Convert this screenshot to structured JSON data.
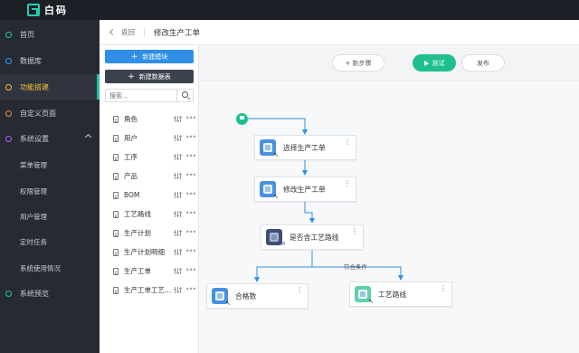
{
  "app": {
    "logo_text": "白码"
  },
  "sidebar": {
    "items": [
      {
        "label": "首页",
        "dot_color": "#20c39f"
      },
      {
        "label": "数据库",
        "dot_color": "#2f9cf4"
      },
      {
        "label": "功能搭建",
        "dot_color": "#f5c13b",
        "active": true
      },
      {
        "label": "自定义页面",
        "dot_color": "#f08a3c"
      },
      {
        "label": "系统设置",
        "dot_color": "#9b6cf0",
        "expanded": true
      }
    ],
    "sub_items": [
      {
        "label": "菜单管理"
      },
      {
        "label": "权限管理"
      },
      {
        "label": "用户管理"
      },
      {
        "label": "定时任务"
      },
      {
        "label": "系统使用情况"
      }
    ],
    "last_item": {
      "label": "系统预览",
      "dot_color": "#20c39f"
    }
  },
  "header": {
    "back_label": "返回",
    "title": "修改生产工单"
  },
  "module_panel": {
    "new_module_label": "新建模块",
    "new_table_label": "新建数据表",
    "search_placeholder": "搜索...",
    "items": [
      {
        "label": "角色"
      },
      {
        "label": "用户"
      },
      {
        "label": "工序"
      },
      {
        "label": "产品"
      },
      {
        "label": "BOM"
      },
      {
        "label": "工艺路线"
      },
      {
        "label": "生产计划"
      },
      {
        "label": "生产计划明细"
      },
      {
        "label": "生产工单"
      },
      {
        "label": "生产工单工艺..."
      }
    ]
  },
  "toolbar": {
    "new_step_label": "+ 新步骤",
    "test_label": "测试",
    "publish_label": "发布"
  },
  "flow": {
    "nodes": [
      {
        "label": "选择生产工单",
        "icon_color": "#4a90e2"
      },
      {
        "label": "修改生产工单",
        "icon_color": "#4a90e2"
      },
      {
        "label": "是否含工艺路线",
        "icon_color": "#3d4f78"
      },
      {
        "label": "合格数",
        "icon_color": "#4a90e2"
      },
      {
        "label": "工艺路线",
        "icon_color": "#5fd0b0"
      }
    ],
    "branch_label": "符合条件"
  },
  "colors": {
    "accent_green": "#1fc08e",
    "accent_blue": "#2f9cf4",
    "sidebar_bg": "#262a33",
    "topbar_bg": "#1c1f26",
    "connector": "#2f8fe6"
  }
}
